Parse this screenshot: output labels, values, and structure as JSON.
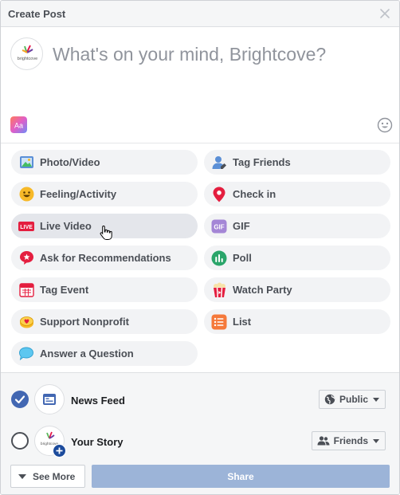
{
  "header": {
    "title": "Create Post"
  },
  "composer": {
    "placeholder": "What's on your mind, Brightcove?"
  },
  "actions_left": [
    {
      "label": "Photo/Video",
      "icon": "photo-video-icon"
    },
    {
      "label": "Feeling/Activity",
      "icon": "feeling-icon"
    },
    {
      "label": "Live Video",
      "icon": "live-video-icon"
    },
    {
      "label": "Ask for Recommendations",
      "icon": "recommendations-icon"
    },
    {
      "label": "Tag Event",
      "icon": "calendar-icon"
    },
    {
      "label": "Support Nonprofit",
      "icon": "nonprofit-icon"
    },
    {
      "label": "Answer a Question",
      "icon": "question-bubble-icon"
    }
  ],
  "actions_right": [
    {
      "label": "Tag Friends",
      "icon": "tag-friends-icon"
    },
    {
      "label": "Check in",
      "icon": "location-pin-icon"
    },
    {
      "label": "GIF",
      "icon": "gif-icon"
    },
    {
      "label": "Poll",
      "icon": "poll-icon"
    },
    {
      "label": "Watch Party",
      "icon": "popcorn-icon"
    },
    {
      "label": "List",
      "icon": "list-icon"
    }
  ],
  "live_badge": "LIVE",
  "gif_badge": "GIF",
  "avatar_text": "brightcove",
  "footer": {
    "news_feed": {
      "label": "News Feed",
      "audience": "Public",
      "checked": true
    },
    "your_story": {
      "label": "Your Story",
      "audience": "Friends",
      "checked": false
    },
    "see_more": "See More",
    "share": "Share"
  },
  "colors": {
    "accent": "#4267b2",
    "share_disabled": "#9cb4d8",
    "live_red": "#e41e3f"
  }
}
